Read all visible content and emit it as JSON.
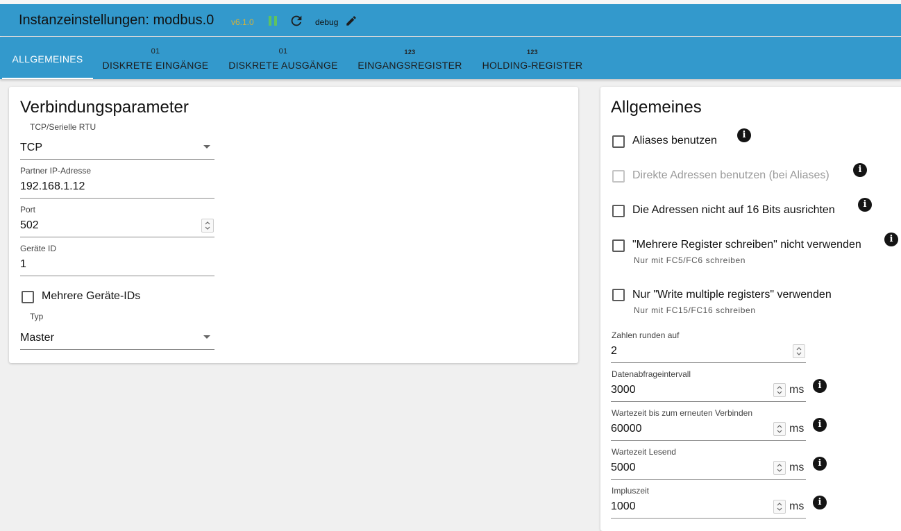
{
  "header": {
    "title": "Instanzeinstellungen: modbus.0",
    "version": "v6.1.0",
    "log_level": "debug"
  },
  "tabs": [
    {
      "label": "ALLGEMEINES",
      "icon": ""
    },
    {
      "label": "DISKRETE EINGÄNGE",
      "icon": "01"
    },
    {
      "label": "DISKRETE AUSGÄNGE",
      "icon": "01"
    },
    {
      "label": "EINGANGSREGISTER",
      "icon": "123"
    },
    {
      "label": "HOLDING-REGISTER",
      "icon": "123"
    }
  ],
  "connection": {
    "title": "Verbindungsparameter",
    "protocol_label": "TCP/Serielle RTU",
    "protocol_value": "TCP",
    "ip_label": "Partner IP-Adresse",
    "ip_value": "192.168.1.12",
    "port_label": "Port",
    "port_value": "502",
    "device_id_label": "Geräte ID",
    "device_id_value": "1",
    "multi_ids_label": "Mehrere Geräte-IDs",
    "type_label": "Typ",
    "type_value": "Master"
  },
  "general": {
    "title": "Allgemeines",
    "options": [
      {
        "label": "Aliases benutzen",
        "helper": "",
        "disabled": false,
        "checked": false
      },
      {
        "label": "Direkte Adressen benutzen (bei Aliases)",
        "helper": "",
        "disabled": true,
        "checked": false
      },
      {
        "label": "Die Adressen nicht auf 16 Bits ausrichten",
        "helper": "",
        "disabled": false,
        "checked": false
      },
      {
        "label": "\"Mehrere Register schreiben\" nicht verwenden",
        "helper": "Nur mit FC5/FC6 schreiben",
        "disabled": false,
        "checked": false
      },
      {
        "label": "Nur \"Write multiple registers\" verwenden",
        "helper": "Nur mit FC15/FC16 schreiben",
        "disabled": false,
        "checked": false
      }
    ],
    "round_label": "Zahlen runden auf",
    "round_value": "2",
    "poll_label": "Datenabfrageintervall",
    "poll_value": "3000",
    "reconnect_label": "Wartezeit bis zum erneuten Verbinden",
    "reconnect_value": "60000",
    "read_timeout_label": "Wartezeit Lesend",
    "read_timeout_value": "5000",
    "pulse_label": "Impluszeit",
    "pulse_value": "1000",
    "unit": "ms"
  },
  "colors": {
    "header_bg": "#3399cc",
    "version_text": "#d4b23a",
    "pause_icon": "#5fc35f"
  }
}
